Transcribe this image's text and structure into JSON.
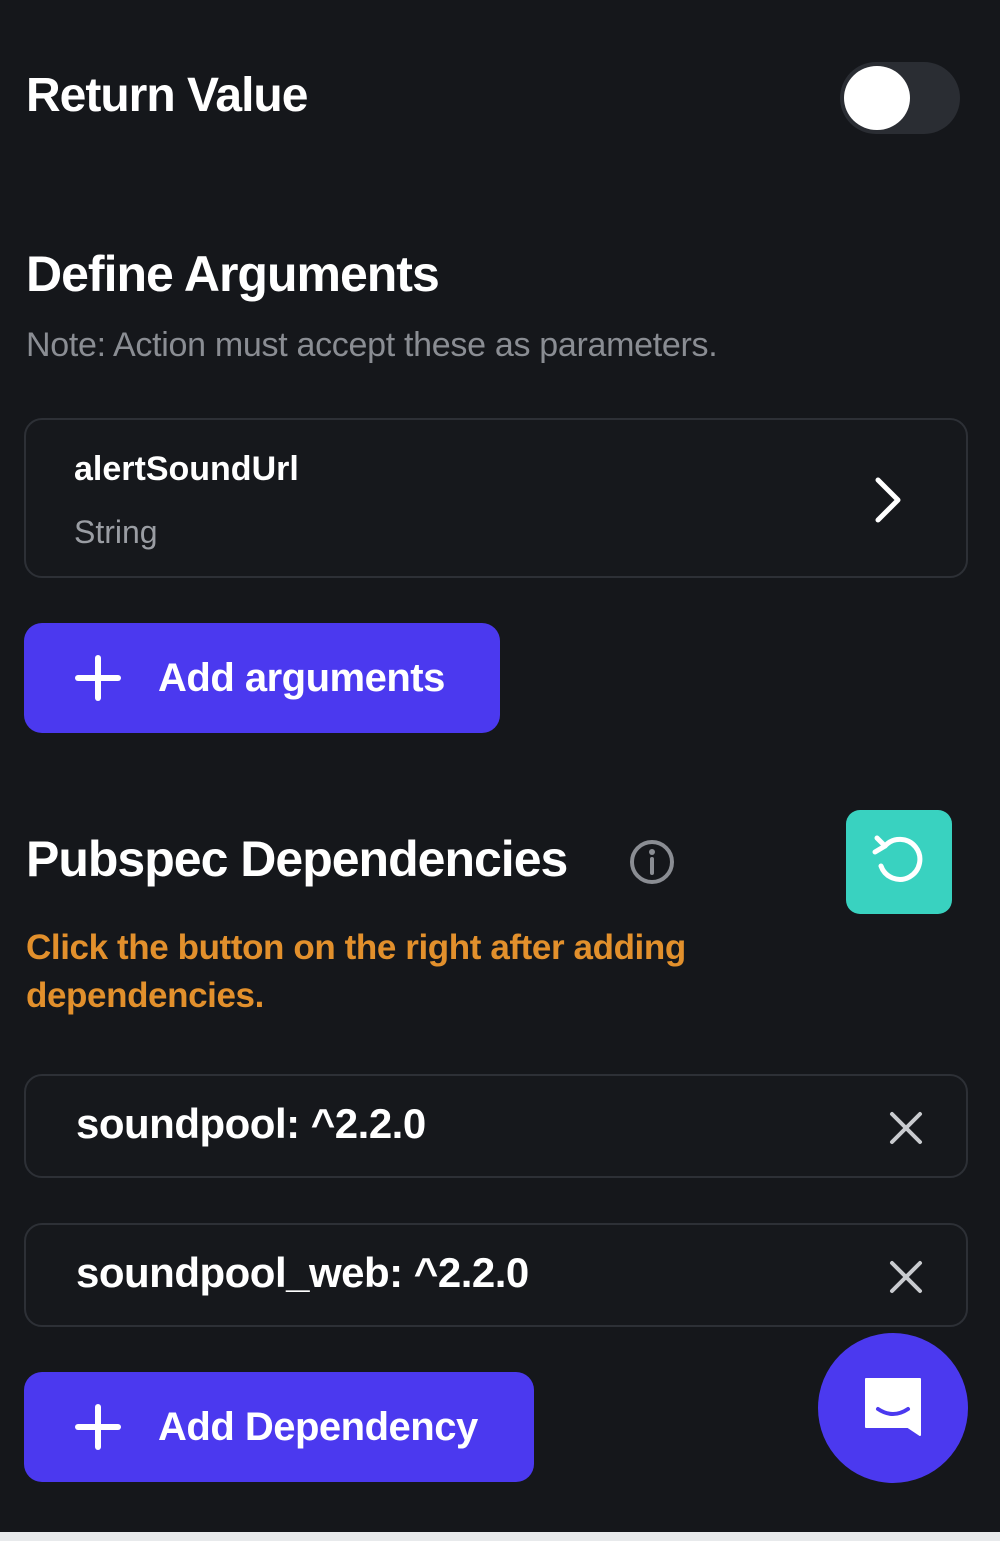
{
  "return_value": {
    "title": "Return Value",
    "toggle_on": false
  },
  "arguments": {
    "title": "Define Arguments",
    "note": "Note: Action must accept these as parameters.",
    "items": [
      {
        "name": "alertSoundUrl",
        "type": "String"
      }
    ],
    "add_label": "Add arguments"
  },
  "pubspec": {
    "title": "Pubspec Dependencies",
    "warning": "Click the button on the right after adding dependencies.",
    "dependencies": [
      "soundpool: ^2.2.0",
      "soundpool_web: ^2.2.0"
    ],
    "add_label": "Add Dependency"
  },
  "colors": {
    "background": "#15171b",
    "primary": "#4b39ef",
    "refresh": "#39d2c0",
    "warning": "#e2902c"
  },
  "icons": [
    "chevron-right-icon",
    "plus-icon",
    "info-icon",
    "refresh-icon",
    "close-icon",
    "chat-icon"
  ]
}
